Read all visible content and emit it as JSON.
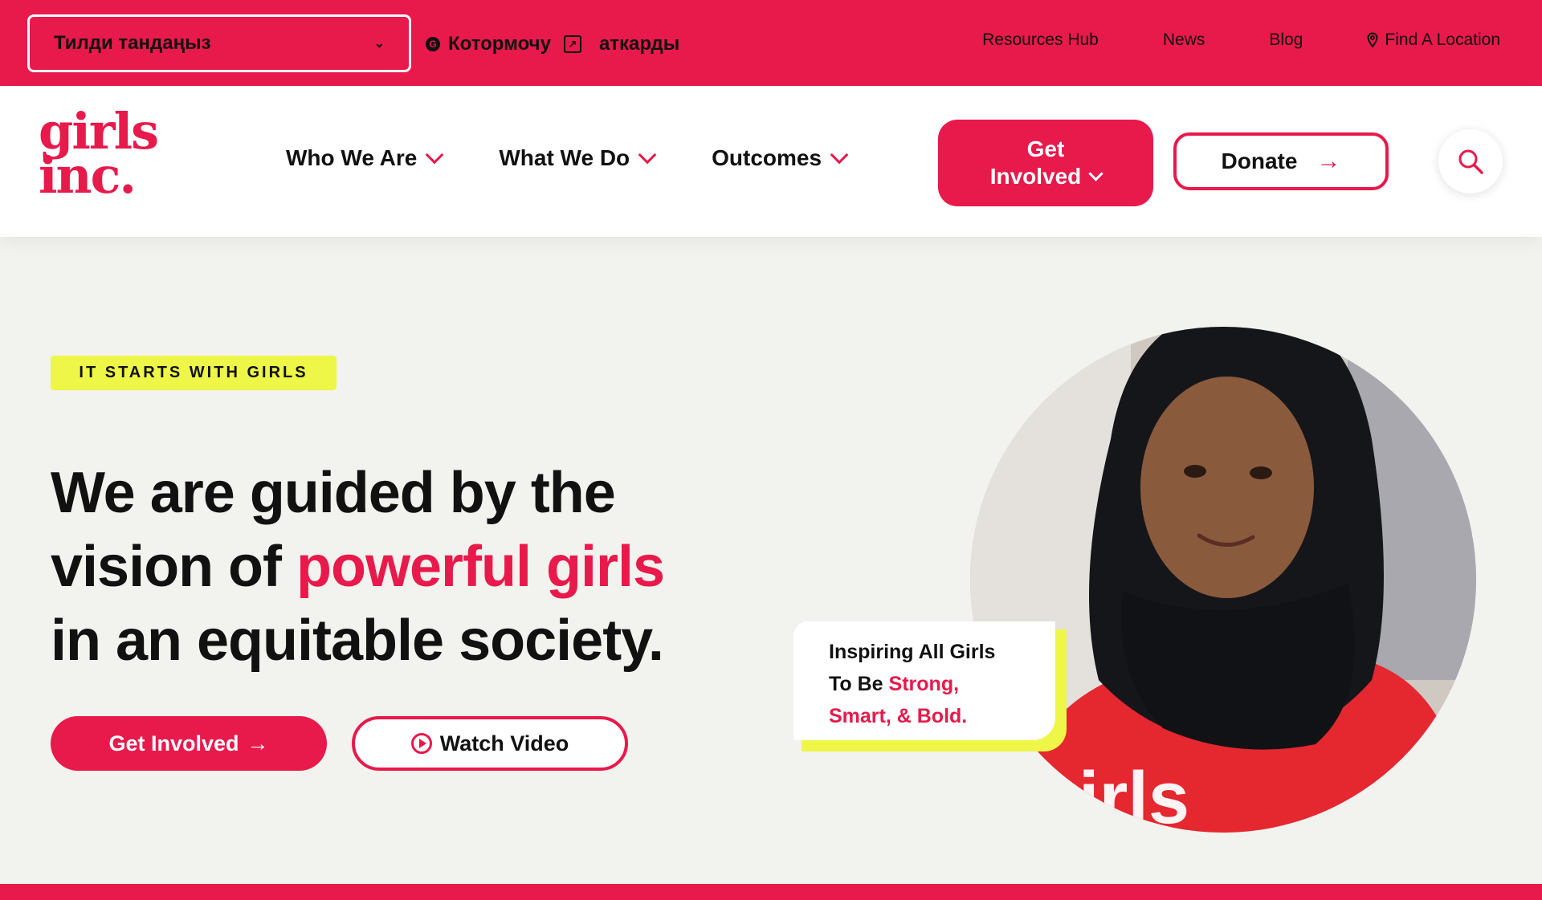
{
  "topbar": {
    "language_select_label": "Тилди тандаңыз",
    "translate_label": "Котормочу",
    "translate_link": "аткарды",
    "links": [
      "Resources Hub",
      "News",
      "Blog",
      "Find A Location"
    ]
  },
  "header": {
    "logo_line1": "girls",
    "logo_line2": "inc.",
    "nav": [
      "Who We Are",
      "What We Do",
      "Outcomes"
    ],
    "get_involved_line1": "Get",
    "get_involved_line2": "Involved",
    "donate_label": "Donate"
  },
  "hero": {
    "badge": "IT STARTS WITH GIRLS",
    "headline_part1": "We are guided by the vision of ",
    "headline_highlight": "powerful girls",
    "headline_part2": " in an equitable society.",
    "cta_primary": "Get Involved",
    "cta_secondary": "Watch Video"
  },
  "quote_card": {
    "line1": "Inspiring All Girls",
    "line2_plain": "To Be ",
    "line2_pink": "Strong,",
    "line3_pink": "Smart,  & Bold."
  },
  "colors": {
    "brand": "#e8194b",
    "accent": "#eef648",
    "background": "#f2f2ee"
  },
  "icons": [
    "google-translate-icon",
    "external-link-icon",
    "map-pin-icon",
    "chevron-down-icon",
    "arrow-right-icon",
    "search-icon",
    "play-icon"
  ]
}
